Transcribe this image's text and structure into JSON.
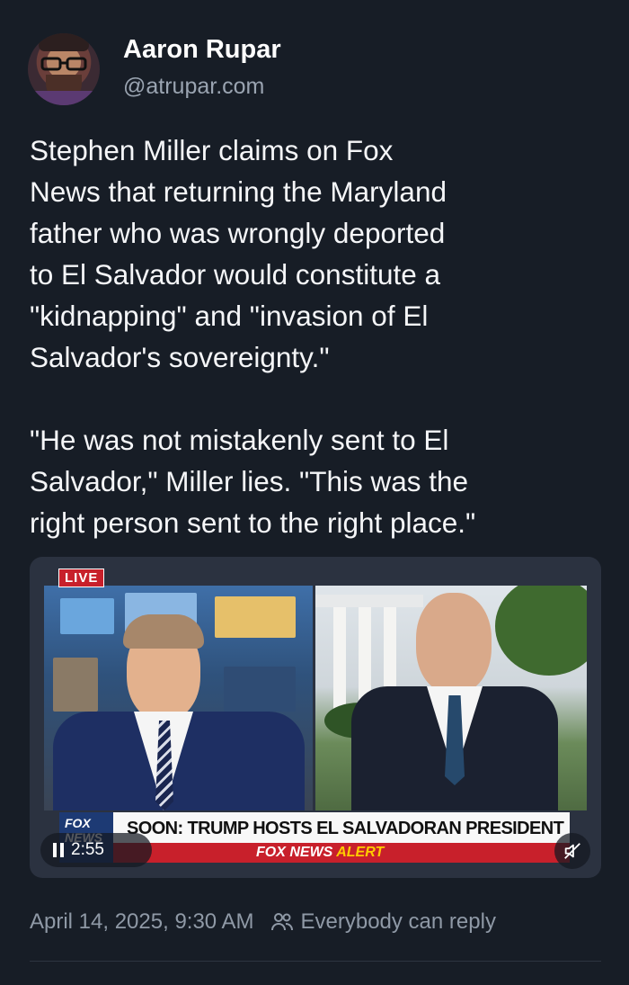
{
  "author": {
    "display_name": "Aaron Rupar",
    "handle": "@atrupar.com"
  },
  "post": {
    "paragraphs": [
      "Stephen Miller claims on Fox\nNews that returning the Maryland\nfather who was wrongly deported\nto El Salvador would constitute a\n\"kidnapping\" and \"invasion of El\nSalvador's sovereignty.\"",
      "\"He was not mistakenly sent to El\nSalvador,\" Miller lies. \"This was the\nright person sent to the right place.\""
    ]
  },
  "video": {
    "live_label": "LIVE",
    "chyron": "SOON: TRUMP HOSTS EL SALVADORAN PRESIDENT",
    "logo_text": "FOX NEWS",
    "alert_brand": "FOX NEWS",
    "alert_word": "ALERT",
    "time_remaining": "2:55",
    "pause_icon": "pause-icon",
    "mute_icon": "muted-speaker-icon"
  },
  "meta": {
    "timestamp": "April 14, 2025, 9:30 AM",
    "reply_setting": "Everybody can reply",
    "reply_icon": "people-icon"
  },
  "colors": {
    "background": "#171d26",
    "secondary_text": "#8f99a6",
    "fox_red": "#c8202b",
    "fox_blue": "#1d3a74"
  }
}
